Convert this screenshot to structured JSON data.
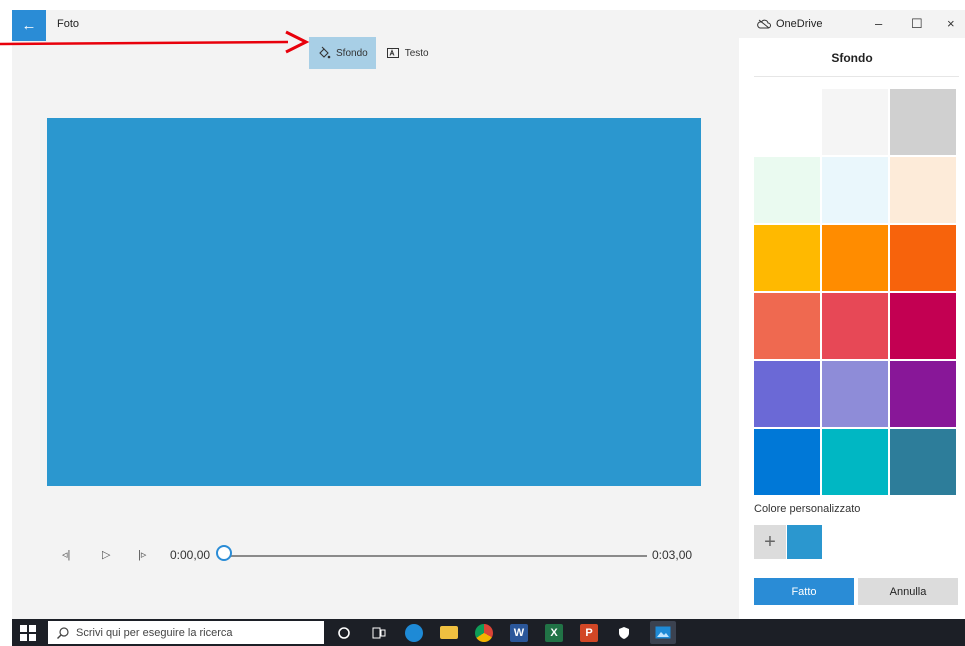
{
  "app": {
    "title": "Foto",
    "back_symbol": "←"
  },
  "toolbar": {
    "background_label": "Sfondo",
    "text_label": "Testo",
    "active_tab": "Sfondo"
  },
  "canvas": {
    "color": "#2b97cf"
  },
  "playback": {
    "current_time": "0:00,00",
    "end_time": "0:03,00",
    "progress": 0
  },
  "window_controls": {
    "onedrive_label": "OneDrive",
    "minimize": "–",
    "maximize": "☐",
    "close": "×"
  },
  "panel": {
    "title": "Sfondo",
    "swatches": [
      {
        "color": "#ffffff"
      },
      {
        "color": "#f5f5f5"
      },
      {
        "color": "#d0d0d0"
      },
      {
        "color": "#eafaf0"
      },
      {
        "color": "#eaf7fc"
      },
      {
        "color": "#fdebd9"
      },
      {
        "color": "#ffb900"
      },
      {
        "color": "#ff8c00"
      },
      {
        "color": "#f7630c"
      },
      {
        "color": "#ef6950"
      },
      {
        "color": "#e74856"
      },
      {
        "color": "#c30052"
      },
      {
        "color": "#6b69d6"
      },
      {
        "color": "#8e8cd8"
      },
      {
        "color": "#881798"
      },
      {
        "color": "#0078d7"
      },
      {
        "color": "#00b7c3"
      },
      {
        "color": "#2d7d9a"
      }
    ],
    "custom_color_label": "Colore personalizzato",
    "custom_add_symbol": "+",
    "custom_color": "#2b97cf",
    "done_label": "Fatto",
    "cancel_label": "Annulla"
  },
  "taskbar": {
    "search_placeholder": "Scrivi qui per eseguire la ricerca",
    "icons": [
      "cortana-icon",
      "task-view-icon",
      "edge-icon",
      "file-explorer-icon",
      "chrome-icon",
      "word-icon",
      "excel-icon",
      "powerpoint-icon",
      "security-icon",
      "photos-icon"
    ]
  },
  "annotation": {
    "arrow_color": "#e8000b"
  }
}
